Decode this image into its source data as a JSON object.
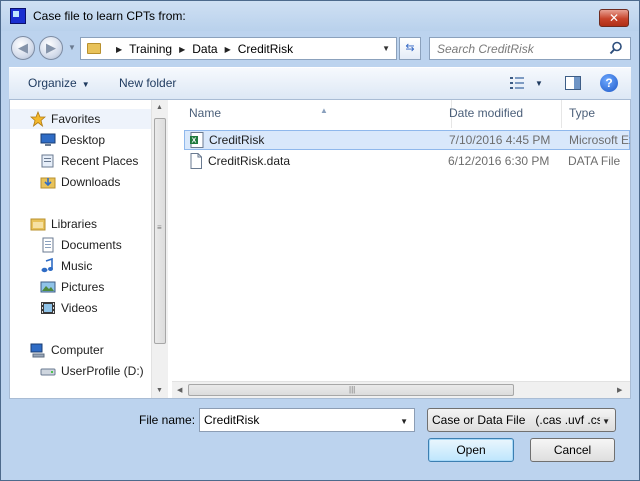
{
  "window": {
    "title": "Case file to learn CPTs from:",
    "close_label": "✕"
  },
  "address": {
    "crumbs": [
      "Training",
      "Data",
      "CreditRisk"
    ]
  },
  "search": {
    "placeholder": "Search CreditRisk"
  },
  "toolbar": {
    "organize_label": "Organize",
    "new_folder_label": "New folder"
  },
  "nav": {
    "favorites_label": "Favorites",
    "favorites": [
      "Desktop",
      "Recent Places",
      "Downloads"
    ],
    "libraries_label": "Libraries",
    "libraries": [
      "Documents",
      "Music",
      "Pictures",
      "Videos"
    ],
    "computer_label": "Computer",
    "computer": [
      "UserProfile (D:)"
    ]
  },
  "files": {
    "columns": [
      "Name",
      "Date modified",
      "Type"
    ],
    "rows": [
      {
        "name": "CreditRisk",
        "date": "7/10/2016 4:45 PM",
        "type": "Microsoft Ex"
      },
      {
        "name": "CreditRisk.data",
        "date": "6/12/2016 6:30 PM",
        "type": "DATA File"
      }
    ]
  },
  "filename": {
    "label": "File name:",
    "value": "CreditRisk"
  },
  "filter": {
    "selected": "Case or Data File   (.cas .uvf .csv"
  },
  "buttons": {
    "open_label": "Open",
    "cancel_label": "Cancel"
  },
  "colors": {
    "frame": "#bcd3ee",
    "selection": "#d9e8fb",
    "accent": "#3c7fb1"
  }
}
